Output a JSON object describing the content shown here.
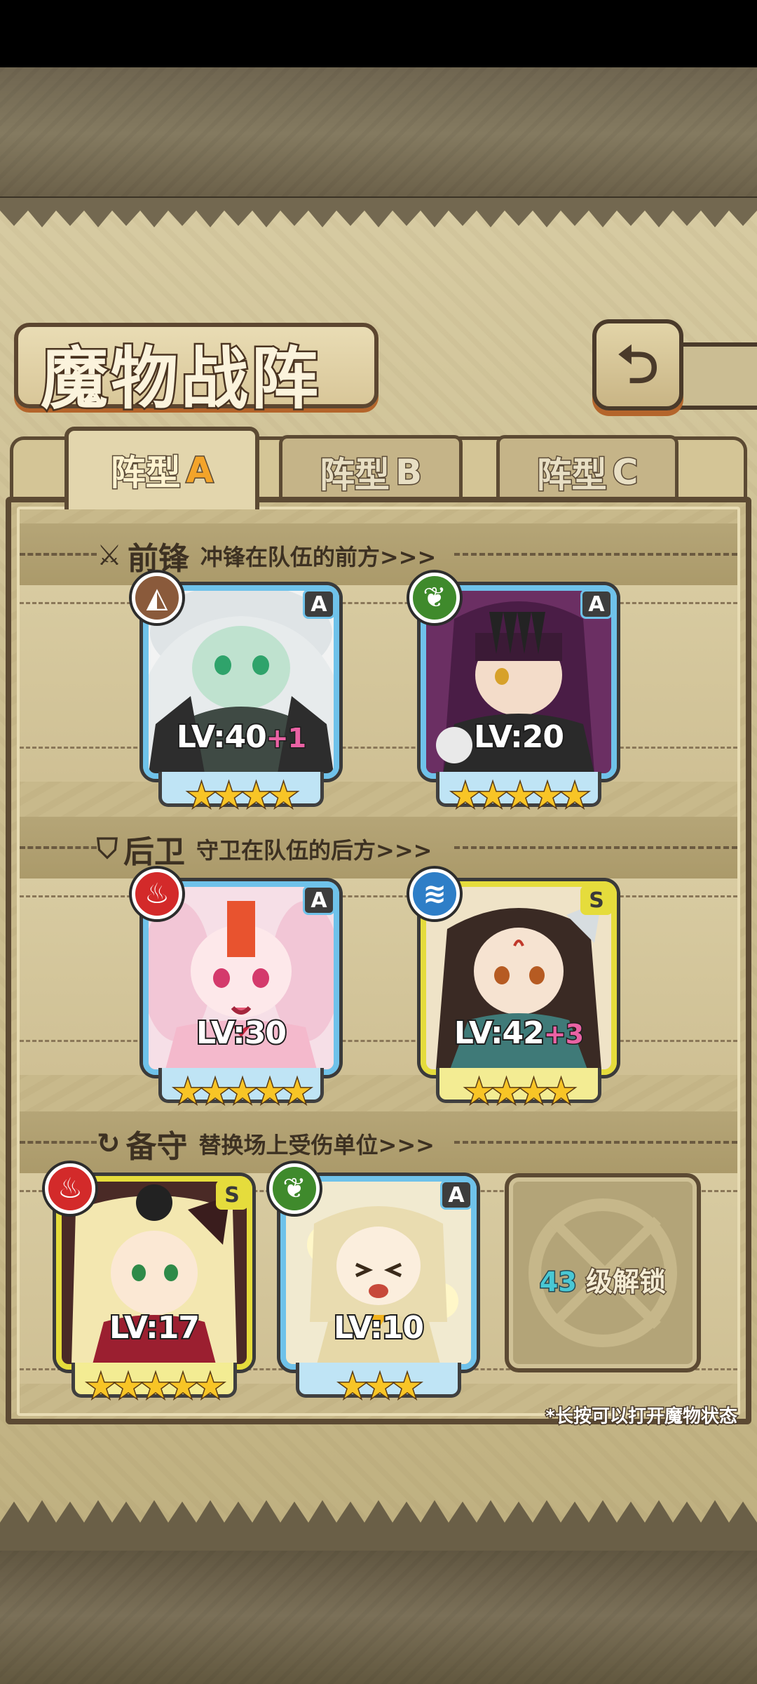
{
  "title": "魔物战阵",
  "back_icon": "back-arrow-icon",
  "tabs": [
    {
      "label": "阵型",
      "letter": "A",
      "active": true
    },
    {
      "label": "阵型",
      "letter": "B",
      "active": false
    },
    {
      "label": "阵型",
      "letter": "C",
      "active": false
    }
  ],
  "sections": {
    "front": {
      "icon": "sword-icon",
      "title": "前锋",
      "subtitle": "冲锋在队伍的前方>>>"
    },
    "rear": {
      "icon": "shield-icon",
      "title": "后卫",
      "subtitle": "守卫在队伍的后方>>>"
    },
    "reserve": {
      "icon": "swap-icon",
      "title": "备守",
      "subtitle": "替换场上受伤单位>>>"
    }
  },
  "cards": {
    "front1": {
      "element": "earth-icon",
      "rank": "A",
      "lv": "LV:40",
      "plus": "+1",
      "stars": 4,
      "stars_text": "★★★★"
    },
    "front2": {
      "element": "leaf-icon",
      "rank": "A",
      "lv": "LV:20",
      "plus": "",
      "stars": 5,
      "stars_text": "★★★★★"
    },
    "rear1": {
      "element": "fire-icon",
      "rank": "A",
      "lv": "LV:30",
      "plus": "",
      "stars": 5,
      "stars_text": "★★★★★"
    },
    "rear2": {
      "element": "water-icon",
      "rank": "S",
      "lv": "LV:42",
      "plus": "+3",
      "stars": 4,
      "stars_text": "★★★★"
    },
    "reserve1": {
      "element": "fire-icon",
      "rank": "S",
      "lv": "LV:17",
      "plus": "",
      "stars": 5,
      "stars_text": "★★★★★"
    },
    "reserve2": {
      "element": "leaf-icon",
      "rank": "A",
      "lv": "LV:10",
      "plus": "",
      "stars": 3,
      "stars_text": "★★★"
    }
  },
  "locked_slot": {
    "level": "43",
    "text": "级解锁"
  },
  "hint": "*长按可以打开魔物状态",
  "colors": {
    "a_rank_frame": "#6fc2ea",
    "s_rank_frame": "#e5dc3c",
    "tab_letter": "#f3a42a",
    "plus_level": "#ea62a4",
    "unlock_level": "#49c8d4"
  }
}
